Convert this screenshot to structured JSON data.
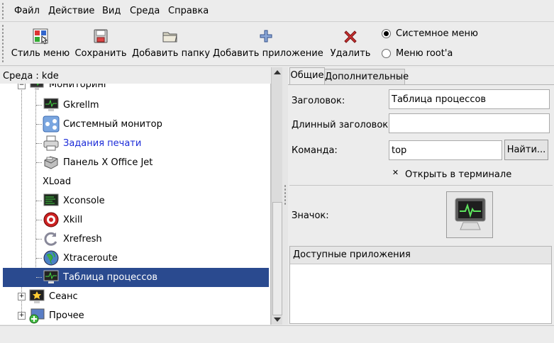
{
  "menubar": {
    "items": [
      "Файл",
      "Действие",
      "Вид",
      "Среда",
      "Справка"
    ]
  },
  "toolbar": {
    "buttons": [
      {
        "label": "Стиль меню",
        "icon": "menu-style-icon"
      },
      {
        "label": "Сохранить",
        "icon": "save-icon"
      },
      {
        "label": "Добавить папку",
        "icon": "folder-icon"
      },
      {
        "label": "Добавить приложение",
        "icon": "add-icon"
      },
      {
        "label": "Удалить",
        "icon": "delete-icon"
      }
    ],
    "menu_mode": {
      "options": [
        "Системное меню",
        "Меню root'а"
      ],
      "selected": "Системное меню"
    }
  },
  "env": {
    "label": "Среда : kde"
  },
  "tree": {
    "parent": {
      "label": "Мониторинг",
      "icon": "monitor-icon",
      "expanded": true
    },
    "children": [
      {
        "label": "Gkrellm",
        "icon": "monitor-icon"
      },
      {
        "label": "Системный монитор",
        "icon": "network-monitor-icon"
      },
      {
        "label": "Задания печати",
        "icon": "printer-icon"
      },
      {
        "label": "Панель X Office Jet",
        "icon": "officejet-printer-icon"
      },
      {
        "label": "XLoad",
        "icon": ""
      },
      {
        "label": "Xconsole",
        "icon": "console-icon"
      },
      {
        "label": "Xkill",
        "icon": "xkill-target-icon"
      },
      {
        "label": "Xrefresh",
        "icon": "refresh-icon"
      },
      {
        "label": "Xtraceroute",
        "icon": "globe-icon"
      },
      {
        "label": "Таблица процессов",
        "icon": "monitor-icon",
        "selected": true
      }
    ],
    "siblings": [
      {
        "label": "Сеанс",
        "icon": "session-icon",
        "expanded": false
      },
      {
        "label": "Прочее",
        "icon": "misc-icon",
        "expanded": false
      }
    ]
  },
  "details": {
    "tabs": [
      {
        "label": "Общие",
        "active": true
      },
      {
        "label": "Дополнительные",
        "active": false
      }
    ],
    "title_label": "Заголовок:",
    "title_value": "Таблица процессов",
    "long_title_label": "Длинный заголовок:",
    "long_title_value": "",
    "command_label": "Команда:",
    "command_value": "top",
    "find_button": "Найти...",
    "terminal_checkbox": {
      "label": "Открыть в терминале",
      "checked": true
    },
    "icon_label": "Значок:",
    "icon_name": "monitor-icon",
    "available_apps_header": "Доступные приложения"
  },
  "colors": {
    "selection": "#2a4a8f",
    "link": "#1b2bd8"
  }
}
